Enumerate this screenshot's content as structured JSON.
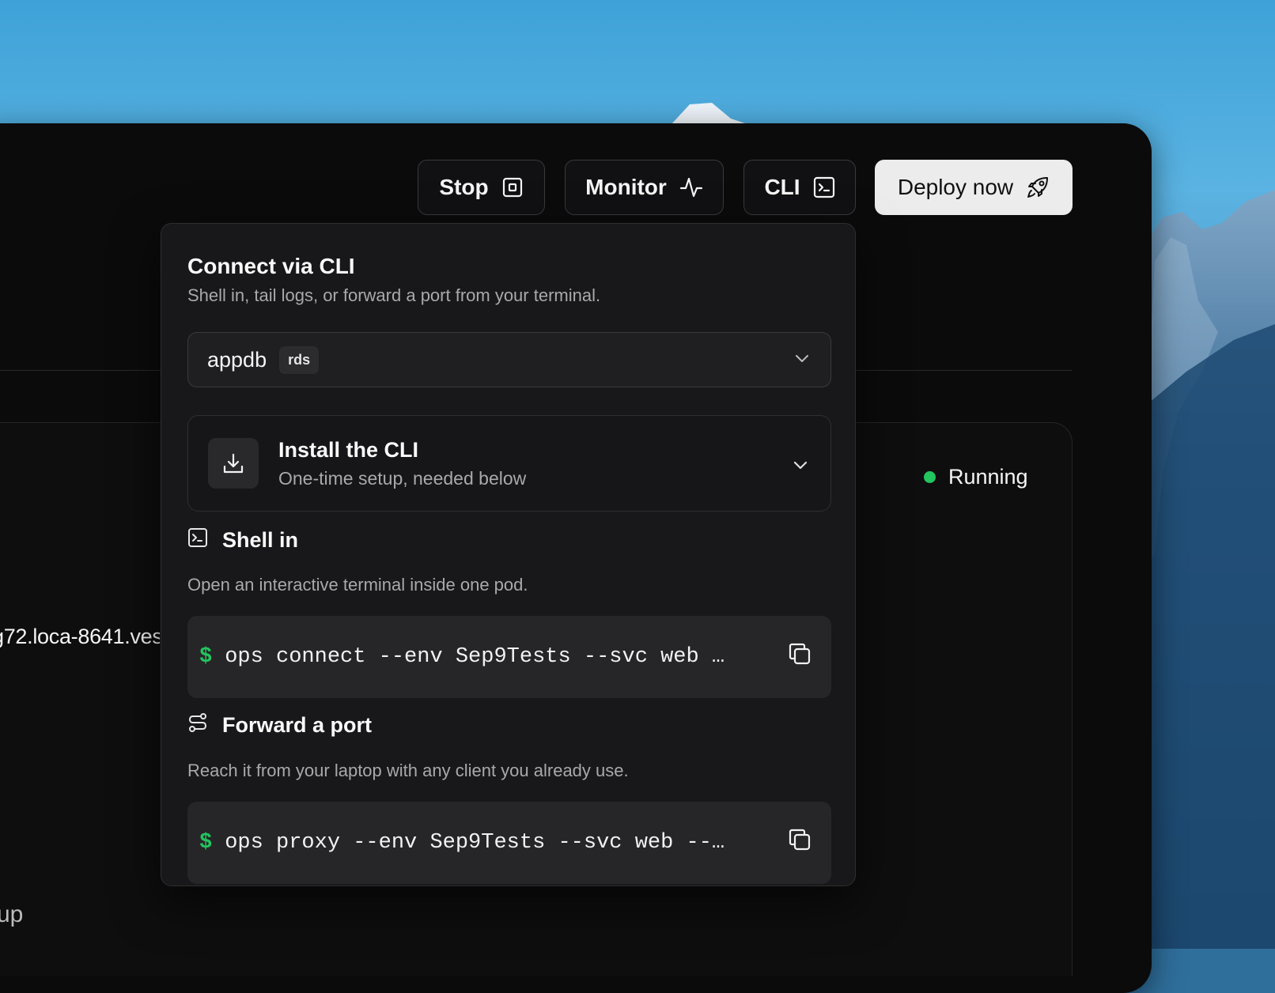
{
  "toolbar": {
    "stop_label": "Stop",
    "monitor_label": "Monitor",
    "cli_label": "CLI",
    "deploy_label": "Deploy now"
  },
  "background": {
    "host_text": "g72.loca-8641.ves",
    "bottom_text": "up",
    "status_text": "Running",
    "status_color": "#22c55e"
  },
  "popover": {
    "title": "Connect via CLI",
    "subtitle": "Shell in, tail logs, or forward a port from your terminal.",
    "select": {
      "value": "appdb",
      "badge": "rds"
    },
    "install": {
      "title": "Install the CLI",
      "subtitle": "One-time setup, needed below"
    },
    "sections": [
      {
        "icon": "terminal-icon",
        "title": "Shell in",
        "description": "Open an interactive terminal inside one pod.",
        "prompt": "$",
        "command": "ops connect --env Sep9Tests --svc web …"
      },
      {
        "icon": "route-icon",
        "title": "Forward a port",
        "description": "Reach it from your laptop with any client you already use.",
        "prompt": "$",
        "command": "ops proxy --env Sep9Tests --svc web --…"
      }
    ]
  },
  "colors": {
    "accent_green": "#22c55e",
    "panel_bg": "#18181a",
    "window_bg": "#0b0b0c",
    "deploy_bg": "#ececec"
  }
}
